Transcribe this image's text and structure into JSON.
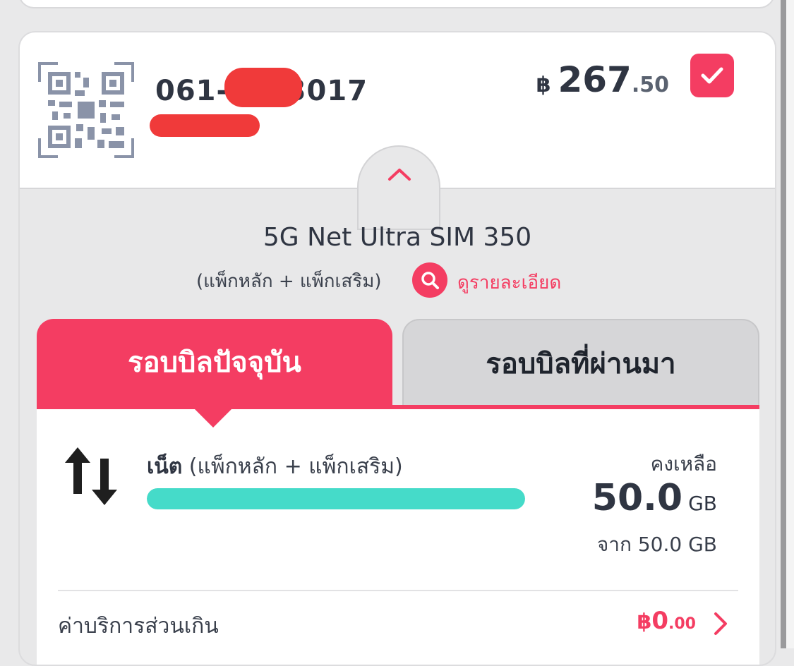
{
  "sim_card": {
    "phone_prefix": "061-",
    "phone_suffix": "-3017",
    "price": {
      "currency": "฿",
      "integer": "267",
      "decimal": ".50"
    },
    "selected": true
  },
  "package": {
    "name": "5G Net Ultra SIM 350",
    "subtitle": "(แพ็กหลัก +  แพ็กเสริม)",
    "detail_link": "ดูรายละเอียด"
  },
  "tabs": [
    {
      "label": "รอบบิลปัจจุบัน",
      "active": true
    },
    {
      "label": "รอบบิลที่ผ่านมา",
      "active": false
    }
  ],
  "usage": {
    "title_bold": "เน็ต",
    "title_rest": " (แพ็กหลัก + แพ็กเสริม)",
    "remaining_label": "คงเหลือ",
    "remaining_value": "50.0",
    "remaining_unit": "GB",
    "total_text": "จาก 50.0 GB",
    "remaining_fraction": 1.0
  },
  "overage": {
    "label": "ค่าบริการส่วนเกิน",
    "currency": "฿",
    "integer": "0",
    "decimal": ".00"
  },
  "icons": {
    "qr": "qr-code-icon",
    "check": "checkmark-icon",
    "collapse": "chevron-up-icon",
    "search": "search-icon",
    "data": "data-transfer-icon",
    "next": "chevron-right-icon"
  },
  "colors": {
    "accent": "#f43d62",
    "progress": "#45dbc9"
  }
}
